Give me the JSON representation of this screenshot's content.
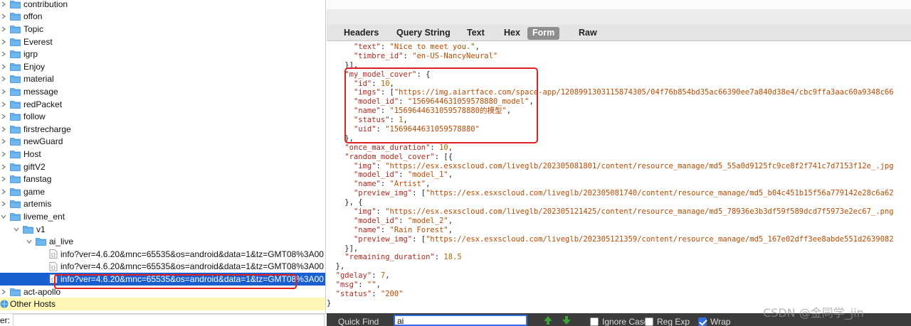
{
  "tree": {
    "rows": [
      {
        "label": "contribution",
        "type": "folder",
        "expanded": false,
        "depth": 0
      },
      {
        "label": "offon",
        "type": "folder",
        "expanded": false,
        "depth": 0
      },
      {
        "label": "Topic",
        "type": "folder",
        "expanded": false,
        "depth": 0
      },
      {
        "label": "Everest",
        "type": "folder",
        "expanded": false,
        "depth": 0
      },
      {
        "label": "igrp",
        "type": "folder",
        "expanded": false,
        "depth": 0
      },
      {
        "label": "Enjoy",
        "type": "folder",
        "expanded": false,
        "depth": 0
      },
      {
        "label": "material",
        "type": "folder",
        "expanded": false,
        "depth": 0
      },
      {
        "label": "message",
        "type": "folder",
        "expanded": false,
        "depth": 0
      },
      {
        "label": "redPacket",
        "type": "folder",
        "expanded": false,
        "depth": 0
      },
      {
        "label": "follow",
        "type": "folder",
        "expanded": false,
        "depth": 0
      },
      {
        "label": "firstrecharge",
        "type": "folder",
        "expanded": false,
        "depth": 0
      },
      {
        "label": "newGuard",
        "type": "folder",
        "expanded": false,
        "depth": 0
      },
      {
        "label": "Host",
        "type": "folder",
        "expanded": false,
        "depth": 0
      },
      {
        "label": "giftV2",
        "type": "folder",
        "expanded": false,
        "depth": 0
      },
      {
        "label": "fanstag",
        "type": "folder",
        "expanded": false,
        "depth": 0
      },
      {
        "label": "game",
        "type": "folder",
        "expanded": false,
        "depth": 0
      },
      {
        "label": "artemis",
        "type": "folder",
        "expanded": false,
        "depth": 0
      },
      {
        "label": "liveme_ent",
        "type": "folder",
        "expanded": true,
        "depth": 0
      },
      {
        "label": "v1",
        "type": "folder",
        "expanded": true,
        "depth": 1
      },
      {
        "label": "ai_live",
        "type": "folder",
        "expanded": true,
        "depth": 2
      },
      {
        "label": "info?ver=4.6.20&mnc=65535&os=android&data=1&tz=GMT08%3A00",
        "type": "file",
        "depth": 3
      },
      {
        "label": "info?ver=4.6.20&mnc=65535&os=android&data=1&tz=GMT08%3A00",
        "type": "file",
        "depth": 3
      },
      {
        "label": "info?ver=4.6.20&mnc=65535&os=android&data=1&tz=GMT08%3A00",
        "type": "file",
        "depth": 3,
        "selected": true
      },
      {
        "label": "act-apollo",
        "type": "folder",
        "expanded": false,
        "depth": 0
      },
      {
        "label": "Other Hosts",
        "type": "globe",
        "depth": 0,
        "highlight": true
      }
    ]
  },
  "filter": {
    "label": "er:",
    "value": ""
  },
  "tabs": [
    "Headers",
    "Query String",
    "Text",
    "Hex",
    "Form",
    "Raw"
  ],
  "active_tab": "Form",
  "code_lines": [
    [
      {
        "c": "p",
        "t": "      "
      },
      {
        "c": "k",
        "t": "\"text\""
      },
      {
        "c": "p",
        "t": ": "
      },
      {
        "c": "s",
        "t": "\"Nice to meet you.\""
      },
      {
        "c": "p",
        "t": ","
      }
    ],
    [
      {
        "c": "p",
        "t": "      "
      },
      {
        "c": "k",
        "t": "\"timbre_id\""
      },
      {
        "c": "p",
        "t": ": "
      },
      {
        "c": "s",
        "t": "\"en-US-NancyNeural\""
      }
    ],
    [
      {
        "c": "p",
        "t": "    }],"
      }
    ],
    [
      {
        "c": "p",
        "t": "    "
      },
      {
        "c": "k",
        "t": "\"my_model_cover\""
      },
      {
        "c": "p",
        "t": ": {"
      }
    ],
    [
      {
        "c": "p",
        "t": "      "
      },
      {
        "c": "k",
        "t": "\"id\""
      },
      {
        "c": "p",
        "t": ": "
      },
      {
        "c": "n",
        "t": "10"
      },
      {
        "c": "p",
        "t": ","
      }
    ],
    [
      {
        "c": "p",
        "t": "      "
      },
      {
        "c": "k",
        "t": "\"imgs\""
      },
      {
        "c": "p",
        "t": ": ["
      },
      {
        "c": "s",
        "t": "\"https://img.aiartface.com/space-app/1208991303115874305/04f76b854bd35ac66390ee7a840d38e4/cbc9ffa3aac60a9348c66"
      }
    ],
    [
      {
        "c": "p",
        "t": "      "
      },
      {
        "c": "k",
        "t": "\"model_id\""
      },
      {
        "c": "p",
        "t": ": "
      },
      {
        "c": "s",
        "t": "\"1569644631059578880_model\""
      },
      {
        "c": "p",
        "t": ","
      }
    ],
    [
      {
        "c": "p",
        "t": "      "
      },
      {
        "c": "k",
        "t": "\"name\""
      },
      {
        "c": "p",
        "t": ": "
      },
      {
        "c": "s",
        "t": "\"1569644631059578880的模型\""
      },
      {
        "c": "p",
        "t": ","
      }
    ],
    [
      {
        "c": "p",
        "t": "      "
      },
      {
        "c": "k",
        "t": "\"status\""
      },
      {
        "c": "p",
        "t": ": "
      },
      {
        "c": "n",
        "t": "1"
      },
      {
        "c": "p",
        "t": ","
      }
    ],
    [
      {
        "c": "p",
        "t": "      "
      },
      {
        "c": "k",
        "t": "\"uid\""
      },
      {
        "c": "p",
        "t": ": "
      },
      {
        "c": "s",
        "t": "\"1569644631059578880\""
      }
    ],
    [
      {
        "c": "p",
        "t": "    },"
      }
    ],
    [
      {
        "c": "p",
        "t": "    "
      },
      {
        "c": "k",
        "t": "\"once_max_duration\""
      },
      {
        "c": "p",
        "t": ": "
      },
      {
        "c": "n",
        "t": "10"
      },
      {
        "c": "p",
        "t": ","
      }
    ],
    [
      {
        "c": "p",
        "t": "    "
      },
      {
        "c": "k",
        "t": "\"random_model_cover\""
      },
      {
        "c": "p",
        "t": ": [{"
      }
    ],
    [
      {
        "c": "p",
        "t": "      "
      },
      {
        "c": "k",
        "t": "\"img\""
      },
      {
        "c": "p",
        "t": ": "
      },
      {
        "c": "s",
        "t": "\"https://esx.esxscloud.com/liveglb/202305081801/content/resource_manage/md5_55a0d9125fc9ce8f2f741c7d7153f12e_.jpg"
      }
    ],
    [
      {
        "c": "p",
        "t": "      "
      },
      {
        "c": "k",
        "t": "\"model_id\""
      },
      {
        "c": "p",
        "t": ": "
      },
      {
        "c": "s",
        "t": "\"model_1\""
      },
      {
        "c": "p",
        "t": ","
      }
    ],
    [
      {
        "c": "p",
        "t": "      "
      },
      {
        "c": "k",
        "t": "\"name\""
      },
      {
        "c": "p",
        "t": ": "
      },
      {
        "c": "s",
        "t": "\"Artist\""
      },
      {
        "c": "p",
        "t": ","
      }
    ],
    [
      {
        "c": "p",
        "t": "      "
      },
      {
        "c": "k",
        "t": "\"preview_img\""
      },
      {
        "c": "p",
        "t": ": ["
      },
      {
        "c": "s",
        "t": "\"https://esx.esxscloud.com/liveglb/202305081740/content/resource_manage/md5_b04c451b15f56a779142e28c6a62"
      }
    ],
    [
      {
        "c": "p",
        "t": "    }, {"
      }
    ],
    [
      {
        "c": "p",
        "t": "      "
      },
      {
        "c": "k",
        "t": "\"img\""
      },
      {
        "c": "p",
        "t": ": "
      },
      {
        "c": "s",
        "t": "\"https://esx.esxscloud.com/liveglb/202305121425/content/resource_manage/md5_78936e3b3df59f589dcd7f5973e2ec67_.png"
      }
    ],
    [
      {
        "c": "p",
        "t": "      "
      },
      {
        "c": "k",
        "t": "\"model_id\""
      },
      {
        "c": "p",
        "t": ": "
      },
      {
        "c": "s",
        "t": "\"model_2\""
      },
      {
        "c": "p",
        "t": ","
      }
    ],
    [
      {
        "c": "p",
        "t": "      "
      },
      {
        "c": "k",
        "t": "\"name\""
      },
      {
        "c": "p",
        "t": ": "
      },
      {
        "c": "s",
        "t": "\"Rain Forest\""
      },
      {
        "c": "p",
        "t": ","
      }
    ],
    [
      {
        "c": "p",
        "t": "      "
      },
      {
        "c": "k",
        "t": "\"preview_img\""
      },
      {
        "c": "p",
        "t": ": ["
      },
      {
        "c": "s",
        "t": "\"https://esx.esxscloud.com/liveglb/202305121359/content/resource_manage/md5_167e02dff3ee8abde551d2639082"
      }
    ],
    [
      {
        "c": "p",
        "t": "    }],"
      }
    ],
    [
      {
        "c": "p",
        "t": "    "
      },
      {
        "c": "k",
        "t": "\"remaining_duration\""
      },
      {
        "c": "p",
        "t": ": "
      },
      {
        "c": "n",
        "t": "18.5"
      }
    ],
    [
      {
        "c": "p",
        "t": "  },"
      }
    ],
    [
      {
        "c": "p",
        "t": "  "
      },
      {
        "c": "k",
        "t": "\"gdelay\""
      },
      {
        "c": "p",
        "t": ": "
      },
      {
        "c": "n",
        "t": "7"
      },
      {
        "c": "p",
        "t": ","
      }
    ],
    [
      {
        "c": "p",
        "t": "  "
      },
      {
        "c": "k",
        "t": "\"msg\""
      },
      {
        "c": "p",
        "t": ": "
      },
      {
        "c": "s",
        "t": "\"\""
      },
      {
        "c": "p",
        "t": ","
      }
    ],
    [
      {
        "c": "p",
        "t": "  "
      },
      {
        "c": "k",
        "t": "\"status\""
      },
      {
        "c": "p",
        "t": ": "
      },
      {
        "c": "s",
        "t": "\"200\""
      }
    ],
    [
      {
        "c": "p",
        "t": "}"
      }
    ]
  ],
  "quick_find": {
    "label": "Quick Find",
    "value": "ai",
    "options": [
      {
        "label": "Ignore Case",
        "checked": false
      },
      {
        "label": "Reg Exp",
        "checked": false
      },
      {
        "label": "Wrap",
        "checked": true
      }
    ]
  },
  "watermark": "CSDN @金同学_jin",
  "colors": {
    "selection": "#1a5fd1",
    "callout": "#e02020",
    "json_key": "#b3281e",
    "json_string": "#c04a00",
    "json_number": "#b06a00"
  }
}
